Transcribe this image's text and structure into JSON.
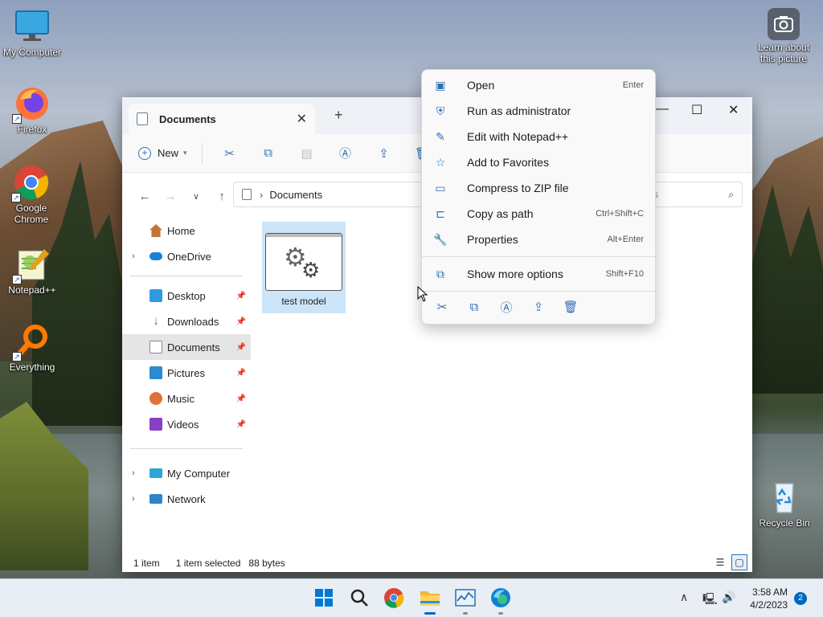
{
  "desktop": {
    "icons": [
      {
        "label": "My Computer",
        "icon": "monitor-icon"
      },
      {
        "label": "Firefox",
        "icon": "firefox-icon"
      },
      {
        "label": "Google Chrome",
        "icon": "chrome-icon"
      },
      {
        "label": "Notepad++",
        "icon": "notepadpp-icon"
      },
      {
        "label": "Everything",
        "icon": "search-magnifier-icon"
      },
      {
        "label": "Learn about this picture",
        "icon": "camera-icon"
      },
      {
        "label": "Recycle Bin",
        "icon": "recycle-bin-icon"
      }
    ]
  },
  "explorer": {
    "tab_title": "Documents",
    "new_label": "New",
    "address": "Documents",
    "search_placeholder": "nts",
    "sidebar": [
      {
        "label": "Home",
        "chevron": false,
        "pinned": false,
        "color": "#c0743a"
      },
      {
        "label": "OneDrive",
        "chevron": true,
        "pinned": false,
        "color": "#1b7fd6"
      },
      {
        "label": "Desktop",
        "chevron": false,
        "pinned": true,
        "color": "#2f9be0"
      },
      {
        "label": "Downloads",
        "chevron": false,
        "pinned": true,
        "color": "#1c9c5c"
      },
      {
        "label": "Documents",
        "chevron": false,
        "pinned": true,
        "color": "#7c8aa0",
        "selected": true
      },
      {
        "label": "Pictures",
        "chevron": false,
        "pinned": true,
        "color": "#2a8ad2"
      },
      {
        "label": "Music",
        "chevron": false,
        "pinned": true,
        "color": "#e0713a"
      },
      {
        "label": "Videos",
        "chevron": false,
        "pinned": true,
        "color": "#8a3fc2"
      },
      {
        "label": "My Computer",
        "chevron": true,
        "pinned": false,
        "color": "#2aa6d8"
      },
      {
        "label": "Network",
        "chevron": true,
        "pinned": false,
        "color": "#2f84c8"
      }
    ],
    "file": {
      "name": "test model"
    },
    "status": {
      "count": "1 item",
      "selected": "1 item selected",
      "size": "88 bytes"
    }
  },
  "context_menu": {
    "items": [
      {
        "label": "Open",
        "shortcut": "Enter",
        "icon": "open-window-icon"
      },
      {
        "label": "Run as administrator",
        "shortcut": "",
        "icon": "shield-icon"
      },
      {
        "label": "Edit with Notepad++",
        "shortcut": "",
        "icon": "pin-icon"
      },
      {
        "label": "Add to Favorites",
        "shortcut": "",
        "icon": "star-icon"
      },
      {
        "label": "Compress to ZIP file",
        "shortcut": "",
        "icon": "zip-icon"
      },
      {
        "label": "Copy as path",
        "shortcut": "Ctrl+Shift+C",
        "icon": "path-icon"
      },
      {
        "label": "Properties",
        "shortcut": "Alt+Enter",
        "icon": "wrench-icon"
      }
    ],
    "more": {
      "label": "Show more options",
      "shortcut": "Shift+F10",
      "icon": "more-options-icon"
    }
  },
  "taskbar": {
    "time": "3:58 AM",
    "date": "4/2/2023",
    "notifications": "2"
  }
}
